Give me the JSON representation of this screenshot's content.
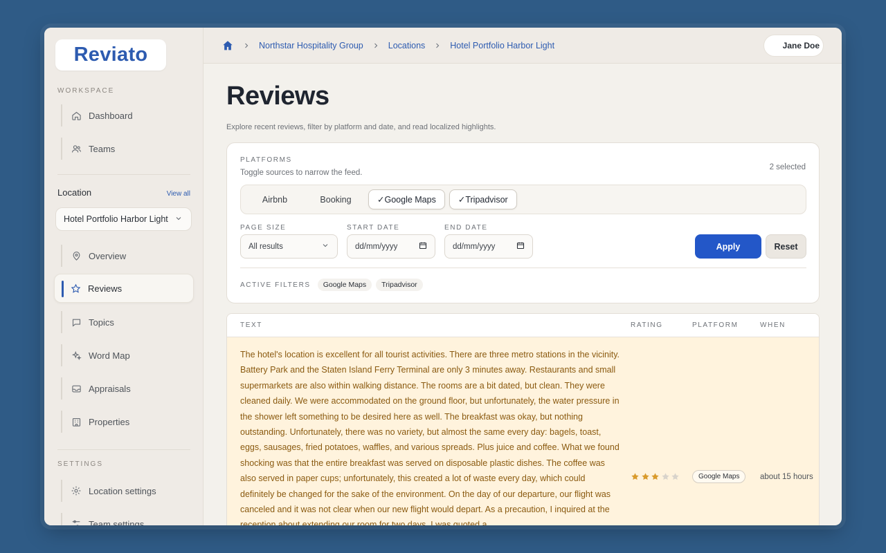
{
  "app": {
    "logo": "Reviato",
    "brand_color": "#2d5bb0",
    "accent_color": "#2357c8",
    "highlight_row_color": "#fff3dd"
  },
  "breadcrumb": [
    {
      "label": "Northstar Hospitality Group"
    },
    {
      "label": "Locations"
    },
    {
      "label": "Hotel Portfolio Harbor Light"
    }
  ],
  "user": {
    "name": "Jane Doe"
  },
  "sidebar": {
    "workspace_label": "WORKSPACE",
    "workspace_items": [
      {
        "label": "Dashboard",
        "icon": "home-icon"
      },
      {
        "label": "Teams",
        "icon": "users-icon"
      }
    ],
    "location_label": "Location",
    "view_all": "View all",
    "location_selected": "Hotel Portfolio Harbor Light",
    "location_items": [
      {
        "label": "Overview",
        "icon": "map-pin-icon"
      },
      {
        "label": "Reviews",
        "icon": "star-icon",
        "active": true
      },
      {
        "label": "Topics",
        "icon": "chat-bubble-icon"
      },
      {
        "label": "Word Map",
        "icon": "sparkles-icon"
      },
      {
        "label": "Appraisals",
        "icon": "inbox-icon"
      },
      {
        "label": "Properties",
        "icon": "building-icon"
      }
    ],
    "settings_label": "SETTINGS",
    "settings_items": [
      {
        "label": "Location settings",
        "icon": "gear-icon"
      },
      {
        "label": "Team settings",
        "icon": "sliders-icon"
      }
    ]
  },
  "page": {
    "title": "Reviews",
    "subtitle": "Explore recent reviews, filter by platform and date, and read localized highlights."
  },
  "filters": {
    "platforms_label": "PLATFORMS",
    "platforms_hint": "Toggle sources to narrow the feed.",
    "selected_count": "2 selected",
    "platforms": [
      {
        "label": "Airbnb",
        "selected": false
      },
      {
        "label": "Booking",
        "selected": false
      },
      {
        "label": "Google Maps",
        "selected": true
      },
      {
        "label": "Tripadvisor",
        "selected": true
      }
    ],
    "check_mark": "✓",
    "page_size_label": "PAGE SIZE",
    "page_size_value": "All results",
    "start_date_label": "START DATE",
    "start_date_placeholder": "dd/mm/yyyy",
    "end_date_label": "END DATE",
    "end_date_placeholder": "dd/mm/yyyy",
    "apply_label": "Apply",
    "reset_label": "Reset",
    "active_filters_label": "ACTIVE FILTERS",
    "active_filters": [
      "Google Maps",
      "Tripadvisor"
    ]
  },
  "table": {
    "columns": [
      "TEXT",
      "RATING",
      "PLATFORM",
      "WHEN"
    ],
    "rows": [
      {
        "text": "The hotel's location is excellent for all tourist activities. There are three metro stations in the vicinity. Battery Park and the Staten Island Ferry Terminal are only 3 minutes away. Restaurants and small supermarkets are also within walking distance. The rooms are a bit dated, but clean. They were cleaned daily. We were accommodated on the ground floor, but unfortunately, the water pressure in the shower left something to be desired here as well. The breakfast was okay, but nothing outstanding. Unfortunately, there was no variety, but almost the same every day: bagels, toast, eggs, sausages, fried potatoes, waffles, and various spreads. Plus juice and coffee. What we found shocking was that the entire breakfast was served on disposable plastic dishes. The coffee was also served in paper cups; unfortunately, this created a lot of waste every day, which could definitely be changed for the sake of the environment. On the day of our departure, our flight was canceled and it was not clear when our new flight would depart. As a precaution, I inquired at the reception about extending our room for two days. I was quoted a",
        "rating": 3,
        "rating_max": 5,
        "platform": "Google Maps",
        "when": "about 15 hours"
      }
    ]
  }
}
